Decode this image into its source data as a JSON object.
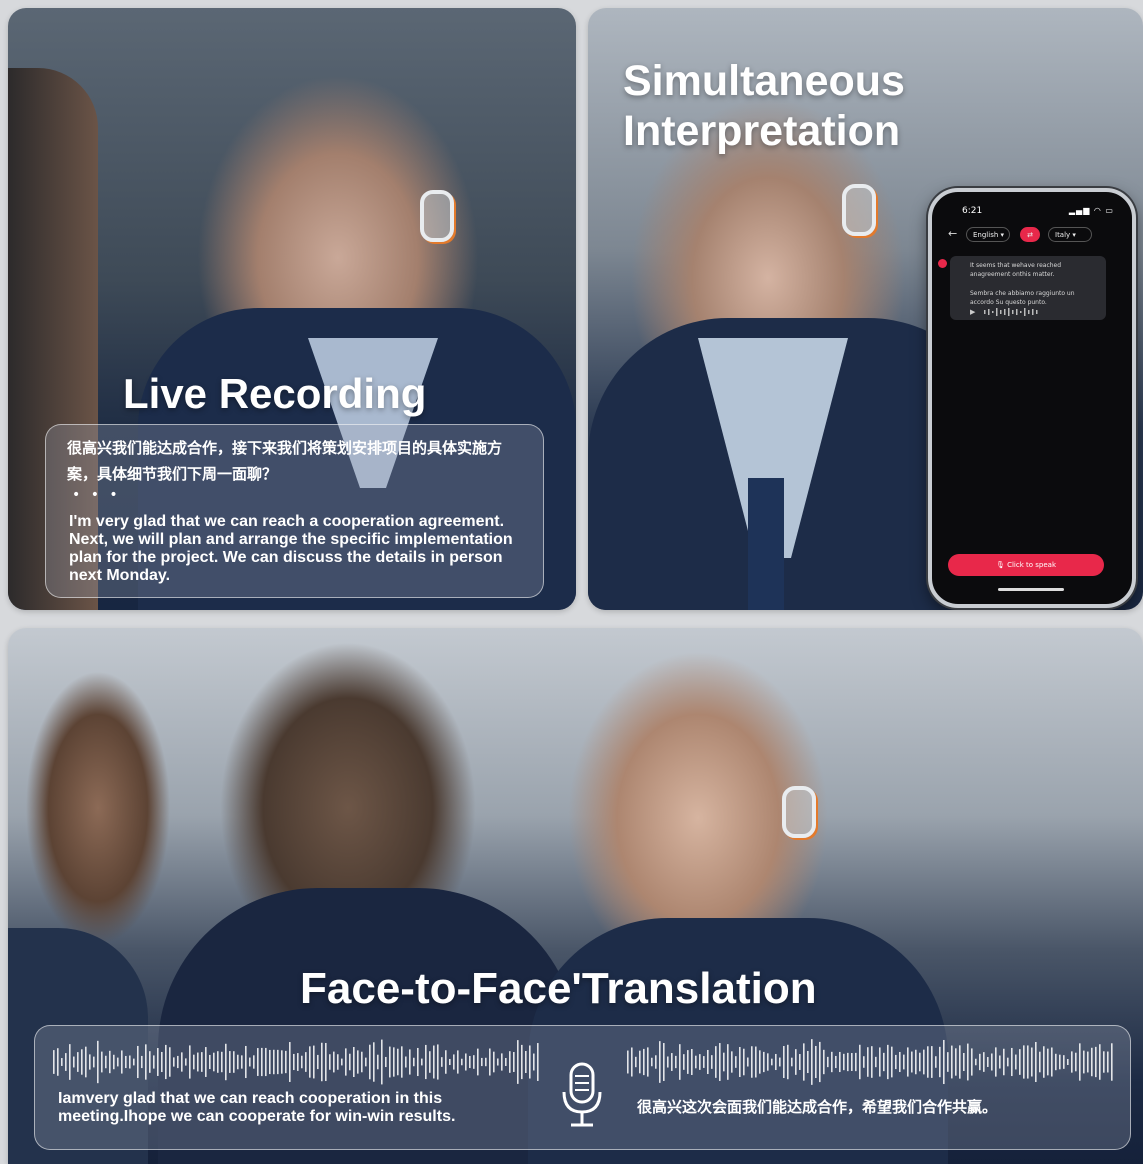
{
  "live": {
    "title": "Live Recording",
    "zh_text": "很高兴我们能达成合作，接下来我们将策划安排项目的具体实施方案，具体细节我们下周一面聊？",
    "dots": "• • •",
    "en_text": "I'm very glad that we can reach a cooperation agreement. Next, we will plan and arrange the specific implementation plan for the project. We can discuss the details in person next Monday."
  },
  "simul": {
    "title_line1": "Simultaneous",
    "title_line2": "Interpretation",
    "phone": {
      "time": "6:21",
      "status_icons": "▂▄▆ ◠ ▭",
      "back_icon": "arrow-left-icon",
      "lang_from": "English ▾",
      "swap_icon": "⇄",
      "lang_to": "Italy ▾",
      "msg_source": "It seems that wehave reached anagreement onthis matter.",
      "msg_target": "Sembra che abbiamo raggiunto un accordo Su questo punto.",
      "play_icon": "▶",
      "speak_label": "🎙 Click to speak"
    }
  },
  "face": {
    "title": "Face-to-Face'Translation",
    "en_text": "Iamvery glad that we can reach cooperation in this meeting.Ihope we can cooperate for win-win results.",
    "zh_text": "很高兴这次会面我们能达成合作，希望我们合作共赢。",
    "mic_icon": "microphone-icon"
  },
  "colors": {
    "accent": "#e8284a",
    "earbud_accent": "#e37a2c"
  }
}
